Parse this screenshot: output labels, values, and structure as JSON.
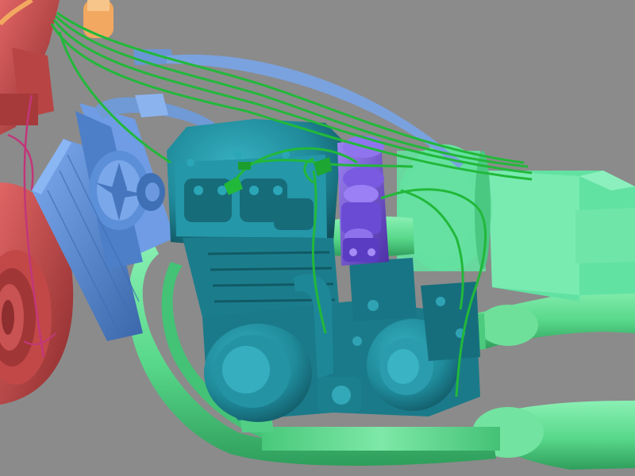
{
  "scene": {
    "subject": "engine-render",
    "colors": {
      "background": "#8a8a8a",
      "frame": "#c94c4c",
      "frame_dark": "#9c3434",
      "radiator": "#5b8fd8",
      "radiator_dark": "#3f6fb5",
      "engine": "#1f8a9a",
      "engine_dark": "#14606d",
      "carburetor": "#7a5ae0",
      "carburetor_dark": "#5637b8",
      "exhaust": "#58d88a",
      "exhaust_dark": "#34a866",
      "airbox": "#5fe3a0",
      "wires": "#22b83a",
      "brake_line": "#c2367a",
      "hose": "#6f9ad6",
      "cap": "#f2a860"
    }
  }
}
